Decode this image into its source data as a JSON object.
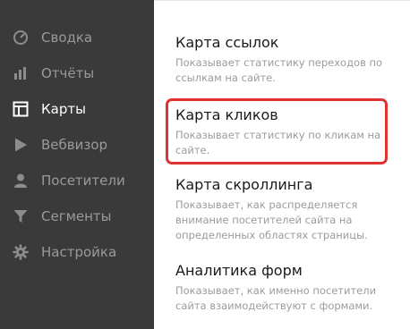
{
  "sidebar": {
    "items": [
      {
        "label": "Сводка",
        "icon": "dashboard-gauge-icon",
        "active": false
      },
      {
        "label": "Отчёты",
        "icon": "bar-chart-icon",
        "active": false
      },
      {
        "label": "Карты",
        "icon": "map-layout-icon",
        "active": true
      },
      {
        "label": "Вебвизор",
        "icon": "play-icon",
        "active": false
      },
      {
        "label": "Посетители",
        "icon": "user-icon",
        "active": false
      },
      {
        "label": "Сегменты",
        "icon": "filter-funnel-icon",
        "active": false
      },
      {
        "label": "Настройка",
        "icon": "gear-icon",
        "active": false
      }
    ]
  },
  "main": {
    "cards": [
      {
        "title": "Карта ссылок",
        "description": "Показывает статистику переходов по ссылкам на сайте."
      },
      {
        "title": "Карта кликов",
        "description": "Показывает статистику по кликам на сайте."
      },
      {
        "title": "Карта скроллинга",
        "description": "Показывает, как распределяется внимание посетителей сайта на определенных областях страницы."
      },
      {
        "title": "Аналитика форм",
        "description": "Показывает, как именно посетители сайта взаимодействуют с формами."
      }
    ]
  },
  "colors": {
    "sidebar_bg": "#3a3a3a",
    "active_text": "#ffffff",
    "inactive_text": "#9a9a9a",
    "highlight": "#e03232"
  }
}
